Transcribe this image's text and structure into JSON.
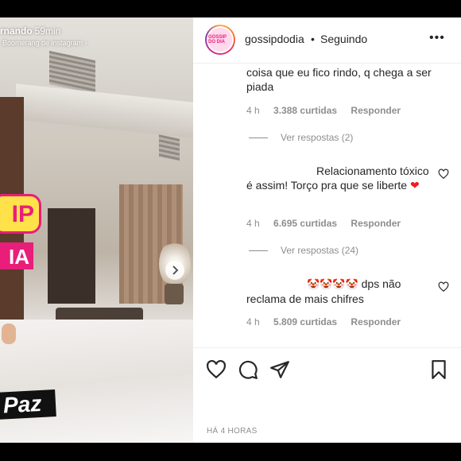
{
  "story": {
    "username_partial": "rnando",
    "time": "59min",
    "subtitle": "Boomerang de instagram ›",
    "stickers": {
      "gossip": "IP",
      "dia": "IA",
      "paz": "Paz"
    }
  },
  "post": {
    "account": "gossipdodia",
    "separator": "•",
    "follow_label": "Seguindo",
    "more_label": "•••",
    "avatar_text": "GOSSIP DO DIA"
  },
  "comments": [
    {
      "text": "coisa que eu fico rindo, q chega a ser piada",
      "age": "4 h",
      "likes": "3.388 curtidas",
      "reply": "Responder",
      "view_replies": "Ver respostas (2)"
    },
    {
      "text": "Relacionamento tóxico é assim! Torço pra que se liberte",
      "emoji": "❤",
      "age": "4 h",
      "likes": "6.695 curtidas",
      "reply": "Responder",
      "view_replies": "Ver respostas (24)"
    },
    {
      "emoji": "🤡🤡🤡🤡",
      "text": "dps não reclama de mais chifres",
      "age": "4 h",
      "likes": "5.809 curtidas",
      "reply": "Responder"
    }
  ],
  "footer": {
    "timestamp": "HÁ 4 HORAS"
  },
  "icons": {
    "like": "heart-icon",
    "comment": "comment-icon",
    "share": "share-icon",
    "save": "bookmark-icon",
    "next": "chevron-right-icon",
    "more": "more-options-icon"
  },
  "colors": {
    "text": "#262626",
    "muted": "#8e8e8e",
    "divider": "#efefef",
    "brand_pink": "#e91e7a",
    "brand_yellow": "#ffe14a",
    "heart_red": "#ed1c24"
  }
}
